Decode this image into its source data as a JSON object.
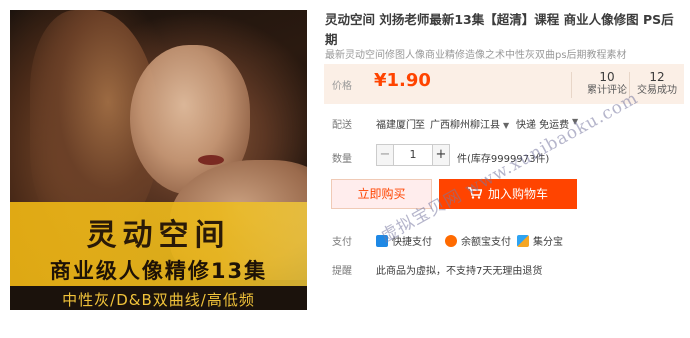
{
  "product": {
    "title": "灵动空间 刘扬老师最新13集【超清】课程 商业人像修图 PS后期",
    "subtitle": "最新灵动空间修图人像商业精修造像之术中性灰双曲ps后期教程素材",
    "image": {
      "promo_title": "灵动空间",
      "promo_subtitle": "商业级人像精修13集",
      "promo_tagline": "中性灰/D&B双曲线/高低频"
    }
  },
  "price": {
    "label": "价格",
    "value": "¥1.90",
    "reviews_count": "10",
    "reviews_label": "累计评论",
    "sales_count": "12",
    "sales_label": "交易成功"
  },
  "shipping": {
    "label": "配送",
    "from": "福建厦门",
    "to_word": "至",
    "destination": "广西柳州柳江县",
    "method": "快递 免运费"
  },
  "quantity": {
    "label": "数量",
    "value": "1",
    "minus": "−",
    "plus": "+",
    "stock": "件(库存9999973件)"
  },
  "actions": {
    "buy_now": "立即购买",
    "add_to_cart": "加入购物车"
  },
  "payment": {
    "label": "支付",
    "methods": [
      "快捷支付",
      "余额宝支付",
      "集分宝"
    ]
  },
  "notice": {
    "label": "提醒",
    "text": "此商品为虚拟，不支持7天无理由退货"
  },
  "watermark": "虚拟宝贝网 www.xunibaoku.com",
  "colors": {
    "accent": "#ff4400",
    "price_bg": "#fbefe6",
    "buy_bg": "#ffeded"
  }
}
